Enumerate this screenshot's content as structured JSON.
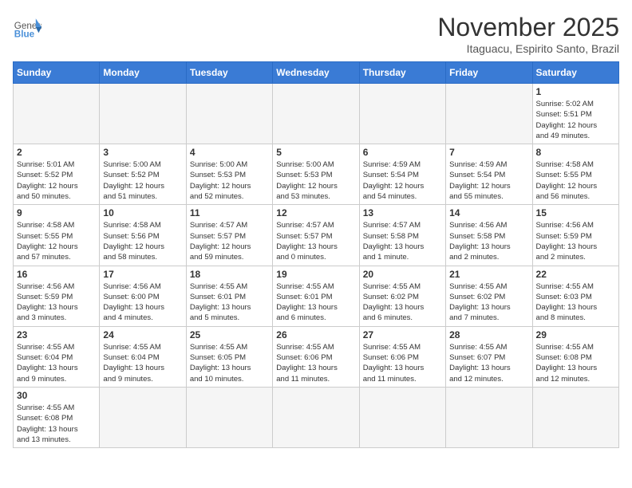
{
  "header": {
    "logo_general": "General",
    "logo_blue": "Blue",
    "month_title": "November 2025",
    "location": "Itaguacu, Espirito Santo, Brazil"
  },
  "weekdays": [
    "Sunday",
    "Monday",
    "Tuesday",
    "Wednesday",
    "Thursday",
    "Friday",
    "Saturday"
  ],
  "days": {
    "d1": {
      "num": "1",
      "info": "Sunrise: 5:02 AM\nSunset: 5:51 PM\nDaylight: 12 hours\nand 49 minutes."
    },
    "d2": {
      "num": "2",
      "info": "Sunrise: 5:01 AM\nSunset: 5:52 PM\nDaylight: 12 hours\nand 50 minutes."
    },
    "d3": {
      "num": "3",
      "info": "Sunrise: 5:00 AM\nSunset: 5:52 PM\nDaylight: 12 hours\nand 51 minutes."
    },
    "d4": {
      "num": "4",
      "info": "Sunrise: 5:00 AM\nSunset: 5:53 PM\nDaylight: 12 hours\nand 52 minutes."
    },
    "d5": {
      "num": "5",
      "info": "Sunrise: 5:00 AM\nSunset: 5:53 PM\nDaylight: 12 hours\nand 53 minutes."
    },
    "d6": {
      "num": "6",
      "info": "Sunrise: 4:59 AM\nSunset: 5:54 PM\nDaylight: 12 hours\nand 54 minutes."
    },
    "d7": {
      "num": "7",
      "info": "Sunrise: 4:59 AM\nSunset: 5:54 PM\nDaylight: 12 hours\nand 55 minutes."
    },
    "d8": {
      "num": "8",
      "info": "Sunrise: 4:58 AM\nSunset: 5:55 PM\nDaylight: 12 hours\nand 56 minutes."
    },
    "d9": {
      "num": "9",
      "info": "Sunrise: 4:58 AM\nSunset: 5:55 PM\nDaylight: 12 hours\nand 57 minutes."
    },
    "d10": {
      "num": "10",
      "info": "Sunrise: 4:58 AM\nSunset: 5:56 PM\nDaylight: 12 hours\nand 58 minutes."
    },
    "d11": {
      "num": "11",
      "info": "Sunrise: 4:57 AM\nSunset: 5:57 PM\nDaylight: 12 hours\nand 59 minutes."
    },
    "d12": {
      "num": "12",
      "info": "Sunrise: 4:57 AM\nSunset: 5:57 PM\nDaylight: 13 hours\nand 0 minutes."
    },
    "d13": {
      "num": "13",
      "info": "Sunrise: 4:57 AM\nSunset: 5:58 PM\nDaylight: 13 hours\nand 1 minute."
    },
    "d14": {
      "num": "14",
      "info": "Sunrise: 4:56 AM\nSunset: 5:58 PM\nDaylight: 13 hours\nand 2 minutes."
    },
    "d15": {
      "num": "15",
      "info": "Sunrise: 4:56 AM\nSunset: 5:59 PM\nDaylight: 13 hours\nand 2 minutes."
    },
    "d16": {
      "num": "16",
      "info": "Sunrise: 4:56 AM\nSunset: 5:59 PM\nDaylight: 13 hours\nand 3 minutes."
    },
    "d17": {
      "num": "17",
      "info": "Sunrise: 4:56 AM\nSunset: 6:00 PM\nDaylight: 13 hours\nand 4 minutes."
    },
    "d18": {
      "num": "18",
      "info": "Sunrise: 4:55 AM\nSunset: 6:01 PM\nDaylight: 13 hours\nand 5 minutes."
    },
    "d19": {
      "num": "19",
      "info": "Sunrise: 4:55 AM\nSunset: 6:01 PM\nDaylight: 13 hours\nand 6 minutes."
    },
    "d20": {
      "num": "20",
      "info": "Sunrise: 4:55 AM\nSunset: 6:02 PM\nDaylight: 13 hours\nand 6 minutes."
    },
    "d21": {
      "num": "21",
      "info": "Sunrise: 4:55 AM\nSunset: 6:02 PM\nDaylight: 13 hours\nand 7 minutes."
    },
    "d22": {
      "num": "22",
      "info": "Sunrise: 4:55 AM\nSunset: 6:03 PM\nDaylight: 13 hours\nand 8 minutes."
    },
    "d23": {
      "num": "23",
      "info": "Sunrise: 4:55 AM\nSunset: 6:04 PM\nDaylight: 13 hours\nand 9 minutes."
    },
    "d24": {
      "num": "24",
      "info": "Sunrise: 4:55 AM\nSunset: 6:04 PM\nDaylight: 13 hours\nand 9 minutes."
    },
    "d25": {
      "num": "25",
      "info": "Sunrise: 4:55 AM\nSunset: 6:05 PM\nDaylight: 13 hours\nand 10 minutes."
    },
    "d26": {
      "num": "26",
      "info": "Sunrise: 4:55 AM\nSunset: 6:06 PM\nDaylight: 13 hours\nand 11 minutes."
    },
    "d27": {
      "num": "27",
      "info": "Sunrise: 4:55 AM\nSunset: 6:06 PM\nDaylight: 13 hours\nand 11 minutes."
    },
    "d28": {
      "num": "28",
      "info": "Sunrise: 4:55 AM\nSunset: 6:07 PM\nDaylight: 13 hours\nand 12 minutes."
    },
    "d29": {
      "num": "29",
      "info": "Sunrise: 4:55 AM\nSunset: 6:08 PM\nDaylight: 13 hours\nand 12 minutes."
    },
    "d30": {
      "num": "30",
      "info": "Sunrise: 4:55 AM\nSunset: 6:08 PM\nDaylight: 13 hours\nand 13 minutes."
    }
  }
}
